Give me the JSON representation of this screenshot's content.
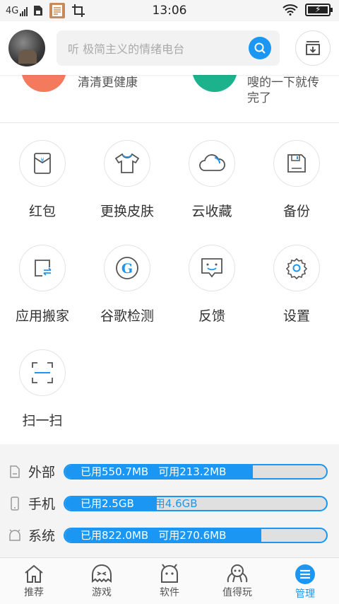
{
  "status_bar": {
    "network": "4G",
    "time": "13:06"
  },
  "header": {
    "search_placeholder": "听 极简主义的情绪电台"
  },
  "partial_row": {
    "left_text": "清清更健康",
    "right_text_line1": "嗖的一下就传",
    "right_text_line2": "完了"
  },
  "tools": [
    {
      "label": "红包",
      "icon": "red-packet-icon"
    },
    {
      "label": "更换皮肤",
      "icon": "tshirt-icon"
    },
    {
      "label": "云收藏",
      "icon": "cloud-icon"
    },
    {
      "label": "备份",
      "icon": "save-icon"
    },
    {
      "label": "应用搬家",
      "icon": "app-move-icon"
    },
    {
      "label": "谷歌检测",
      "icon": "google-icon"
    },
    {
      "label": "反馈",
      "icon": "feedback-icon"
    },
    {
      "label": "设置",
      "icon": "gear-icon"
    },
    {
      "label": "扫一扫",
      "icon": "scan-icon"
    }
  ],
  "storage": [
    {
      "label": "外部",
      "used": "已用550.7MB",
      "free": "可用213.2MB",
      "used_fraction": 0.72
    },
    {
      "label": "手机",
      "used": "已用2.5GB",
      "free": "可用4.6GB",
      "used_fraction": 0.35
    },
    {
      "label": "系统",
      "used": "已用822.0MB",
      "free": "可用270.6MB",
      "used_fraction": 0.75
    }
  ],
  "nav": [
    {
      "label": "推荐",
      "icon": "home-icon"
    },
    {
      "label": "游戏",
      "icon": "game-icon"
    },
    {
      "label": "软件",
      "icon": "android-icon"
    },
    {
      "label": "值得玩",
      "icon": "mascot-icon"
    },
    {
      "label": "管理",
      "icon": "manage-icon",
      "active": true
    }
  ],
  "colors": {
    "accent": "#1b97f3",
    "coral": "#f47a5e",
    "teal": "#1bb28c"
  }
}
